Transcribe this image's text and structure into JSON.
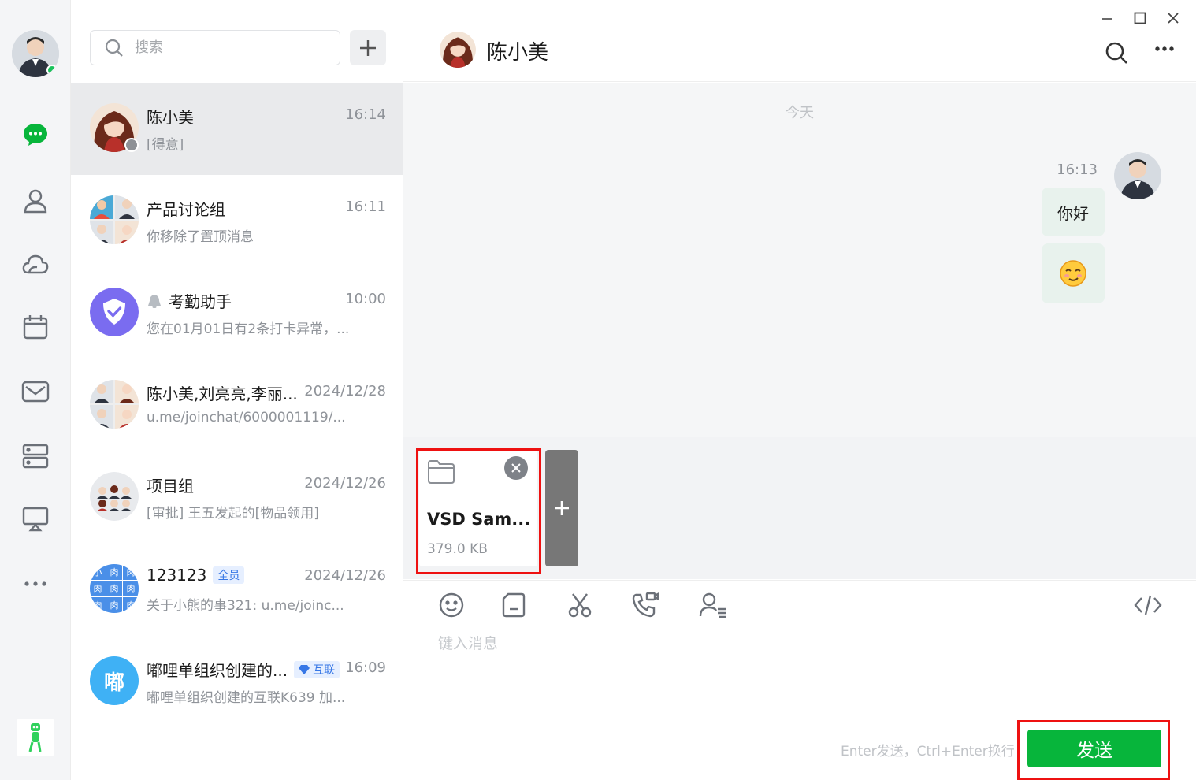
{
  "sidebar": {
    "nav": [
      "messages-icon",
      "contacts-icon",
      "cloud-icon",
      "calendar-icon",
      "mail-icon",
      "storage-icon",
      "screen-share-icon",
      "more-icon"
    ]
  },
  "search": {
    "placeholder": "搜索"
  },
  "conversations": [
    {
      "name": "陈小美",
      "time": "16:14",
      "preview": "[得意]"
    },
    {
      "name": "产品讨论组",
      "time": "16:11",
      "preview": "你移除了置顶消息"
    },
    {
      "name": "考勤助手",
      "time": "10:00",
      "preview": "您在01月01日有2条打卡异常，..."
    },
    {
      "name": "陈小美,刘亮亮,李丽...",
      "time": "2024/12/28",
      "preview": "u.me/joinchat/6000001119/..."
    },
    {
      "name": "项目组",
      "time": "2024/12/26",
      "preview": "[审批] 王五发起的[物品领用]"
    },
    {
      "name": "123123",
      "tag": "全员",
      "time": "2024/12/26",
      "preview": "关于小熊的事321: u.me/joinc..."
    },
    {
      "name": "嘟哩单组织创建的...",
      "tag": "互联",
      "avatar_text": "嘟",
      "time": "16:09",
      "preview": "嘟哩单组织创建的互联K639 加..."
    }
  ],
  "avatar_tile_text": "肉",
  "avatar_tile_text2": "小",
  "chat": {
    "title": "陈小美",
    "day_label": "今天",
    "messages": [
      {
        "time": "16:13",
        "text": "你好"
      }
    ]
  },
  "attachment": {
    "name": "VSD Sam...",
    "size": "379.0 KB"
  },
  "composer": {
    "placeholder": "键入消息",
    "hint": "Enter发送，Ctrl+Enter换行",
    "send_label": "发送"
  },
  "colors": {
    "accent": "#07b53b",
    "highlight": "#ee1111",
    "tag_blue": "#3777e6"
  }
}
